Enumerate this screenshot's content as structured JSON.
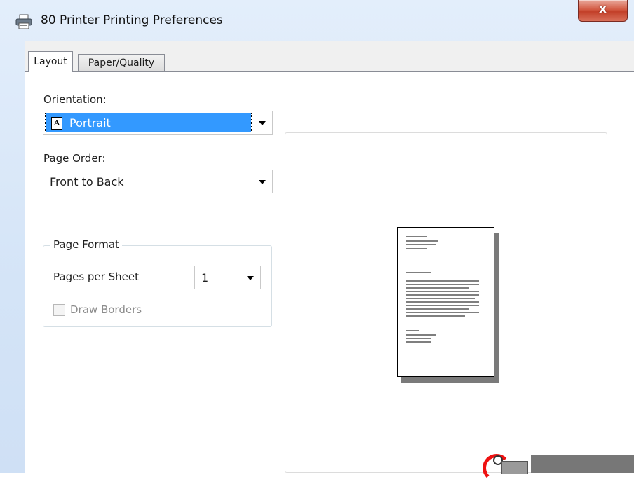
{
  "window": {
    "title": "80 Printer Printing Preferences",
    "close_label": "x"
  },
  "tabs": [
    {
      "label": "Layout",
      "active": true
    },
    {
      "label": "Paper/Quality",
      "active": false
    }
  ],
  "layout": {
    "orientation_label": "Orientation:",
    "orientation_value": "Portrait",
    "orientation_icon_glyph": "A",
    "page_order_label": "Page Order:",
    "page_order_value": "Front to Back",
    "page_format_title": "Page Format",
    "pages_per_sheet_label": "Pages per Sheet",
    "pages_per_sheet_value": "1",
    "draw_borders_label": "Draw Borders",
    "draw_borders_checked": false,
    "draw_borders_enabled": false
  },
  "icons": {
    "title": "printer-icon",
    "close": "close-icon",
    "dropdown": "chevron-down-icon"
  },
  "colors": {
    "selection": "#3399ff",
    "close_button": "#c94a33",
    "disabled_text": "#8c8c8c"
  }
}
